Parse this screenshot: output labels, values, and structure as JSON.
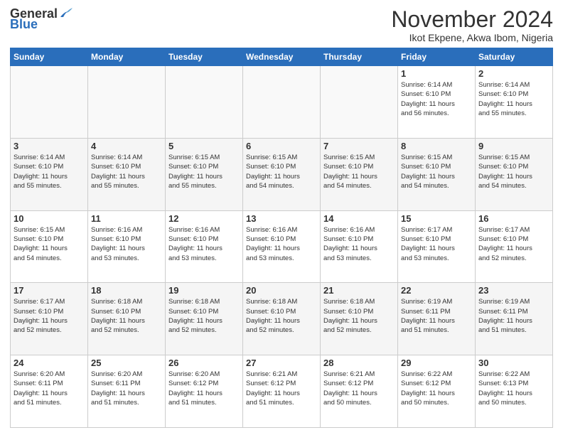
{
  "header": {
    "logo": {
      "general": "General",
      "blue": "Blue"
    },
    "title": "November 2024",
    "location": "Ikot Ekpene, Akwa Ibom, Nigeria"
  },
  "weekdays": [
    "Sunday",
    "Monday",
    "Tuesday",
    "Wednesday",
    "Thursday",
    "Friday",
    "Saturday"
  ],
  "weeks": [
    [
      {
        "day": "",
        "info": ""
      },
      {
        "day": "",
        "info": ""
      },
      {
        "day": "",
        "info": ""
      },
      {
        "day": "",
        "info": ""
      },
      {
        "day": "",
        "info": ""
      },
      {
        "day": "1",
        "info": "Sunrise: 6:14 AM\nSunset: 6:10 PM\nDaylight: 11 hours\nand 56 minutes."
      },
      {
        "day": "2",
        "info": "Sunrise: 6:14 AM\nSunset: 6:10 PM\nDaylight: 11 hours\nand 55 minutes."
      }
    ],
    [
      {
        "day": "3",
        "info": "Sunrise: 6:14 AM\nSunset: 6:10 PM\nDaylight: 11 hours\nand 55 minutes."
      },
      {
        "day": "4",
        "info": "Sunrise: 6:14 AM\nSunset: 6:10 PM\nDaylight: 11 hours\nand 55 minutes."
      },
      {
        "day": "5",
        "info": "Sunrise: 6:15 AM\nSunset: 6:10 PM\nDaylight: 11 hours\nand 55 minutes."
      },
      {
        "day": "6",
        "info": "Sunrise: 6:15 AM\nSunset: 6:10 PM\nDaylight: 11 hours\nand 54 minutes."
      },
      {
        "day": "7",
        "info": "Sunrise: 6:15 AM\nSunset: 6:10 PM\nDaylight: 11 hours\nand 54 minutes."
      },
      {
        "day": "8",
        "info": "Sunrise: 6:15 AM\nSunset: 6:10 PM\nDaylight: 11 hours\nand 54 minutes."
      },
      {
        "day": "9",
        "info": "Sunrise: 6:15 AM\nSunset: 6:10 PM\nDaylight: 11 hours\nand 54 minutes."
      }
    ],
    [
      {
        "day": "10",
        "info": "Sunrise: 6:15 AM\nSunset: 6:10 PM\nDaylight: 11 hours\nand 54 minutes."
      },
      {
        "day": "11",
        "info": "Sunrise: 6:16 AM\nSunset: 6:10 PM\nDaylight: 11 hours\nand 53 minutes."
      },
      {
        "day": "12",
        "info": "Sunrise: 6:16 AM\nSunset: 6:10 PM\nDaylight: 11 hours\nand 53 minutes."
      },
      {
        "day": "13",
        "info": "Sunrise: 6:16 AM\nSunset: 6:10 PM\nDaylight: 11 hours\nand 53 minutes."
      },
      {
        "day": "14",
        "info": "Sunrise: 6:16 AM\nSunset: 6:10 PM\nDaylight: 11 hours\nand 53 minutes."
      },
      {
        "day": "15",
        "info": "Sunrise: 6:17 AM\nSunset: 6:10 PM\nDaylight: 11 hours\nand 53 minutes."
      },
      {
        "day": "16",
        "info": "Sunrise: 6:17 AM\nSunset: 6:10 PM\nDaylight: 11 hours\nand 52 minutes."
      }
    ],
    [
      {
        "day": "17",
        "info": "Sunrise: 6:17 AM\nSunset: 6:10 PM\nDaylight: 11 hours\nand 52 minutes."
      },
      {
        "day": "18",
        "info": "Sunrise: 6:18 AM\nSunset: 6:10 PM\nDaylight: 11 hours\nand 52 minutes."
      },
      {
        "day": "19",
        "info": "Sunrise: 6:18 AM\nSunset: 6:10 PM\nDaylight: 11 hours\nand 52 minutes."
      },
      {
        "day": "20",
        "info": "Sunrise: 6:18 AM\nSunset: 6:10 PM\nDaylight: 11 hours\nand 52 minutes."
      },
      {
        "day": "21",
        "info": "Sunrise: 6:18 AM\nSunset: 6:10 PM\nDaylight: 11 hours\nand 52 minutes."
      },
      {
        "day": "22",
        "info": "Sunrise: 6:19 AM\nSunset: 6:11 PM\nDaylight: 11 hours\nand 51 minutes."
      },
      {
        "day": "23",
        "info": "Sunrise: 6:19 AM\nSunset: 6:11 PM\nDaylight: 11 hours\nand 51 minutes."
      }
    ],
    [
      {
        "day": "24",
        "info": "Sunrise: 6:20 AM\nSunset: 6:11 PM\nDaylight: 11 hours\nand 51 minutes."
      },
      {
        "day": "25",
        "info": "Sunrise: 6:20 AM\nSunset: 6:11 PM\nDaylight: 11 hours\nand 51 minutes."
      },
      {
        "day": "26",
        "info": "Sunrise: 6:20 AM\nSunset: 6:12 PM\nDaylight: 11 hours\nand 51 minutes."
      },
      {
        "day": "27",
        "info": "Sunrise: 6:21 AM\nSunset: 6:12 PM\nDaylight: 11 hours\nand 51 minutes."
      },
      {
        "day": "28",
        "info": "Sunrise: 6:21 AM\nSunset: 6:12 PM\nDaylight: 11 hours\nand 50 minutes."
      },
      {
        "day": "29",
        "info": "Sunrise: 6:22 AM\nSunset: 6:12 PM\nDaylight: 11 hours\nand 50 minutes."
      },
      {
        "day": "30",
        "info": "Sunrise: 6:22 AM\nSunset: 6:13 PM\nDaylight: 11 hours\nand 50 minutes."
      }
    ]
  ]
}
